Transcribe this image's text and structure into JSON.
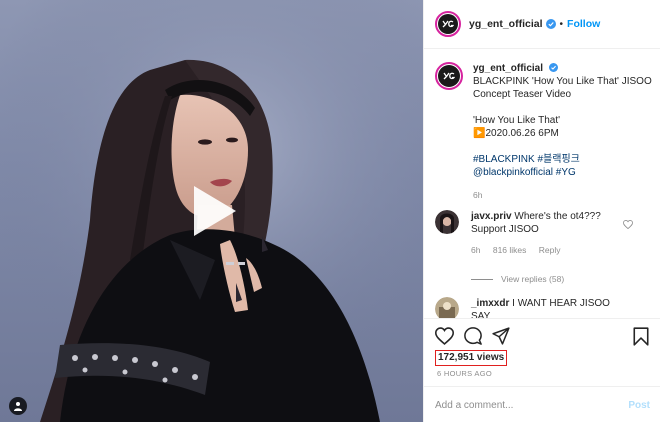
{
  "header": {
    "username": "yg_ent_official",
    "separator": "•",
    "follow_label": "Follow"
  },
  "caption": {
    "username": "yg_ent_official",
    "title_line1": "BLACKPINK 'How You Like That' JISOO",
    "title_line2": "Concept Teaser Video",
    "song": "'How You Like That'",
    "date": "▶️2020.06.26 6PM",
    "hashtags": [
      "#BLACKPINK",
      "#블랙핑크"
    ],
    "mention": "@blackpinkofficial",
    "hashtag_yg": "#YG",
    "age": "6h"
  },
  "comments": [
    {
      "username": "javx.priv",
      "text": "Where's the ot4??? Support JISOO",
      "age": "6h",
      "likes": "816 likes",
      "reply": "Reply",
      "view_replies": "View replies (58)"
    },
    {
      "username": "_imxxdr",
      "text": "I WANT HEAR JISOO SAY"
    }
  ],
  "stats": {
    "views": "172,951 views",
    "posted": "6 HOURS AGO"
  },
  "composer": {
    "placeholder": "Add a comment...",
    "post_label": "Post"
  },
  "icons": {
    "play": "play-icon",
    "user_tag": "user-tag-icon",
    "verified": "verified-badge-icon",
    "heart": "heart-icon",
    "comment": "comment-icon",
    "share": "share-icon",
    "bookmark": "bookmark-icon"
  },
  "colors": {
    "follow": "#0095f6",
    "hashtag": "#00376b",
    "highlight_box": "#e0201f",
    "secondary_text": "#8e8e8e"
  }
}
